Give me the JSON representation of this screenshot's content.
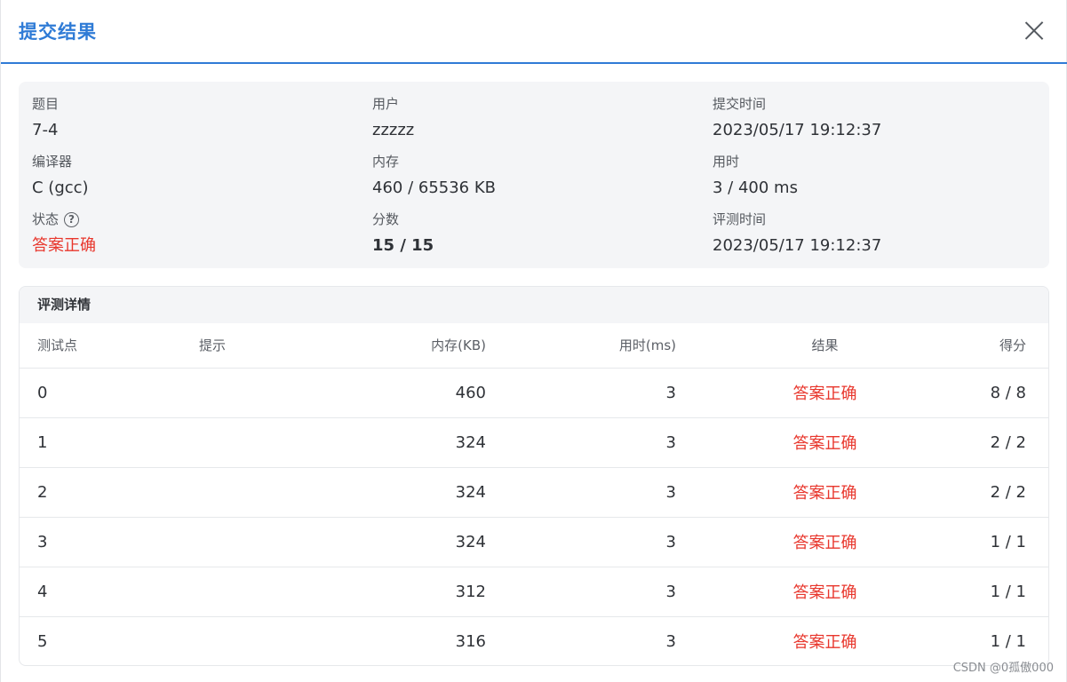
{
  "dialog": {
    "title": "提交结果",
    "close_icon": "close-icon"
  },
  "summary": {
    "problem_label": "题目",
    "problem_value": "7-4",
    "user_label": "用户",
    "user_value": "zzzzz",
    "submit_time_label": "提交时间",
    "submit_time_value": "2023/05/17 19:12:37",
    "compiler_label": "编译器",
    "compiler_value": "C (gcc)",
    "memory_label": "内存",
    "memory_value": "460 / 65536 KB",
    "time_label": "用时",
    "time_value": "3 / 400 ms",
    "status_label": "状态",
    "status_help_icon": "?",
    "status_value": "答案正确",
    "score_label": "分数",
    "score_value": "15 / 15",
    "judge_time_label": "评测时间",
    "judge_time_value": "2023/05/17 19:12:37"
  },
  "details": {
    "title": "评测详情",
    "columns": [
      "测试点",
      "提示",
      "内存(KB)",
      "用时(ms)",
      "结果",
      "得分"
    ],
    "rows": [
      [
        "0",
        "",
        "460",
        "3",
        "答案正确",
        "8 / 8"
      ],
      [
        "1",
        "",
        "324",
        "3",
        "答案正确",
        "2 / 2"
      ],
      [
        "2",
        "",
        "324",
        "3",
        "答案正确",
        "2 / 2"
      ],
      [
        "3",
        "",
        "324",
        "3",
        "答案正确",
        "1 / 1"
      ],
      [
        "4",
        "",
        "312",
        "3",
        "答案正确",
        "1 / 1"
      ],
      [
        "5",
        "",
        "316",
        "3",
        "答案正确",
        "1 / 1"
      ]
    ]
  },
  "watermark": "CSDN @0孤傲000",
  "colors": {
    "accent": "#2f7bd6",
    "accepted": "#e8362c"
  }
}
